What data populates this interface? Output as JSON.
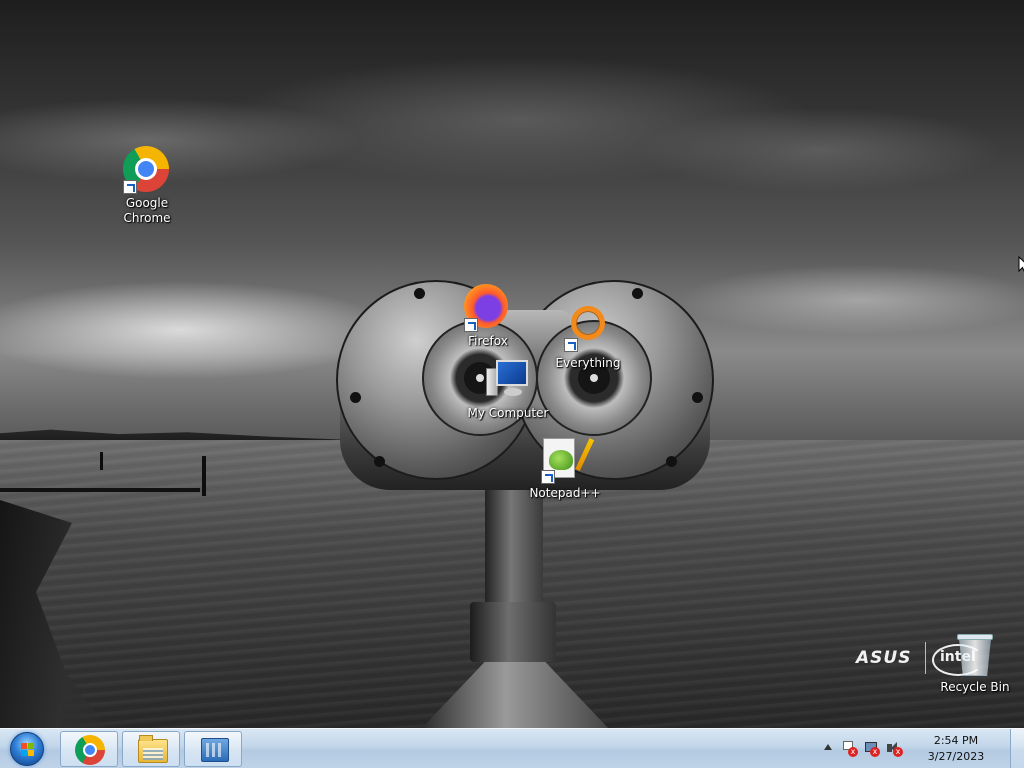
{
  "desktop": {
    "icons": [
      {
        "label": "Google\nChrome",
        "icon": "chrome-icon"
      },
      {
        "label": "Firefox",
        "icon": "firefox-icon"
      },
      {
        "label": "Everything",
        "icon": "everything-icon"
      },
      {
        "label": "My Computer",
        "icon": "computer-icon"
      },
      {
        "label": "Notepad++",
        "icon": "notepadpp-icon"
      },
      {
        "label": "Recycle Bin",
        "icon": "recycle-bin-icon"
      }
    ],
    "wallpaper_brands": {
      "asus": "ASUS",
      "intel": "intel"
    }
  },
  "taskbar": {
    "pinned": [
      {
        "name": "Google Chrome",
        "icon": "chrome-icon"
      },
      {
        "name": "Windows Explorer",
        "icon": "folder-icon"
      },
      {
        "name": "Control Panel",
        "icon": "control-panel-icon"
      }
    ],
    "clock": {
      "time": "2:54 PM",
      "date": "3/27/2023"
    }
  },
  "colors": {
    "taskbar": "#c2d6ea",
    "start_orb": "#2f7fd6",
    "everything_ring": "#f28a1c"
  }
}
